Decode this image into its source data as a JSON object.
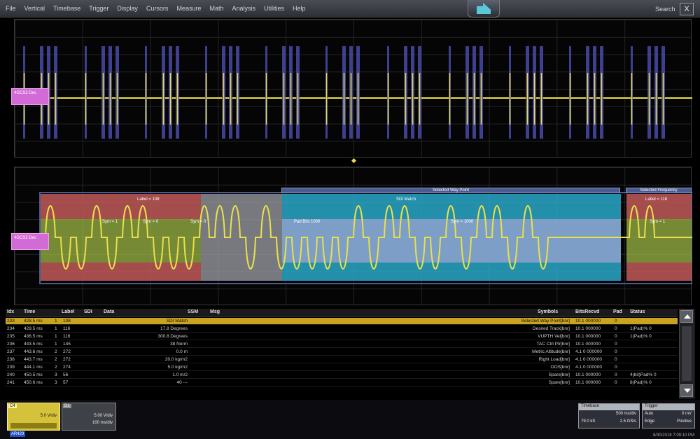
{
  "menu": {
    "items": [
      "File",
      "Vertical",
      "Timebase",
      "Trigger",
      "Display",
      "Cursors",
      "Measure",
      "Math",
      "Analysis",
      "Utilities",
      "Help"
    ],
    "search_label": "Search",
    "close_label": "X"
  },
  "colors": {
    "trace": "#e8e04a",
    "decode_bits": "#4a4aa8",
    "red_band": "#c25a5a",
    "green_band": "#a6c24a",
    "cyan_band": "#2aa8c8",
    "selected_row": "#c9a21f",
    "channel_label": "#d36bd6"
  },
  "waveform_top": {
    "channel_label": "4GCS2 Dec",
    "channel_sub": "Dec"
  },
  "waveform_bottom": {
    "channel_label": "4GCS2 Dec",
    "channel_sub": "Dec",
    "header_left": "Selected Way Point",
    "header_right": "Selected Frequency",
    "box_red_label": "Label = 108",
    "box_cyan_label": "SDI Match",
    "box_right_label": "Label = 118",
    "inner_labels": [
      "Sym = 1",
      "Sym = 0",
      "Sym = 0",
      "Pad Bits 1000",
      "Sym = 1000",
      "Sym = 1"
    ]
  },
  "table": {
    "headers": [
      "Idx",
      "Time",
      "Label",
      "SDI",
      "Data",
      "SSM",
      "Msg",
      "Symbols",
      "BitsRecvd",
      "Pad",
      "Status"
    ],
    "rows": [
      {
        "idx": "233",
        "time": "428.5 ms",
        "ch": "1",
        "label": "108",
        "data": "SDI Match",
        "msg": "Selected Way Point",
        "symbols": "Selected Way Point[bnr]",
        "bitsrecvd": "10.1 000000",
        "pad": "0",
        "status": "",
        "selected": true
      },
      {
        "idx": "234",
        "time": "429.5 ms",
        "ch": "1",
        "label": "116",
        "data": "17.8 Degrees",
        "msg": "",
        "symbols": "Desired Track[bnr]",
        "bitsrecvd": "10.1 000000",
        "pad": "0",
        "status": "1(Pad)% 0"
      },
      {
        "idx": "235",
        "time": "436.5 ms",
        "ch": "1",
        "label": "116",
        "data": "300.8 Degrees",
        "msg": "",
        "symbols": "VUPTH Vel[bnr]",
        "bitsrecvd": "10.1 000000",
        "pad": "0",
        "status": "1(Pad)% 0"
      },
      {
        "idx": "236",
        "time": "443.5 ms",
        "ch": "1",
        "label": "145",
        "data": "38 Norm",
        "msg": "",
        "symbols": "TAC Ctrl Ptr[bnr]",
        "bitsrecvd": "10.1 000000",
        "pad": "0",
        "status": ""
      },
      {
        "idx": "237",
        "time": "443.6 ms",
        "ch": "2",
        "label": "272",
        "data": "0.0 m",
        "msg": "",
        "symbols": "Metric Altitude[bnr]",
        "bitsrecvd": "4.1 0 000000",
        "pad": "0",
        "status": ""
      },
      {
        "idx": "238",
        "time": "443.7 ms",
        "ch": "2",
        "label": "272",
        "data": "20.0 kg/m2",
        "msg": "",
        "symbols": "Right Load[bnr]",
        "bitsrecvd": "4.1 0 000000",
        "pad": "0",
        "status": ""
      },
      {
        "idx": "239",
        "time": "444.1 ms",
        "ch": "2",
        "label": "274",
        "data": "5.0 kg/m2",
        "msg": "",
        "symbols": "OOS[bnr]",
        "bitsrecvd": "4.1 0 000000",
        "pad": "0",
        "status": ""
      },
      {
        "idx": "240",
        "time": "450.5 ms",
        "ch": "3",
        "label": "56",
        "data": "1.0 m/2",
        "msg": "",
        "symbols": "Spare[bnr]",
        "bitsrecvd": "10.1 000000",
        "pad": "0",
        "status": "4(bit)Pad% 0"
      },
      {
        "idx": "241",
        "time": "450.6 ms",
        "ch": "3",
        "label": "57",
        "data": "40 ---",
        "msg": "",
        "symbols": "Spare[bnr]",
        "bitsrecvd": "10.1 000000",
        "pad": "0",
        "status": "8(Pad)% 0"
      }
    ]
  },
  "bottom": {
    "channel_tag": "C4",
    "channel_value": "5.0 V/div",
    "decode_tag": "D1",
    "decode_line1": "5.00 V/div",
    "decode_line2": "100 ms/div",
    "badge": "AR429",
    "timebase_header": "Timebase",
    "timebase_value": "500 ms/div",
    "timebase_rate": "79.0 kS",
    "timebase_samples": "2.5 GS/s",
    "trigger_header": "Trigger",
    "trigger_mode": "Auto",
    "trigger_level": "0 mV",
    "trigger_type": "Edge",
    "trigger_slope": "Positive",
    "timestamp": "8/30/2018 7:09:10 PM"
  }
}
